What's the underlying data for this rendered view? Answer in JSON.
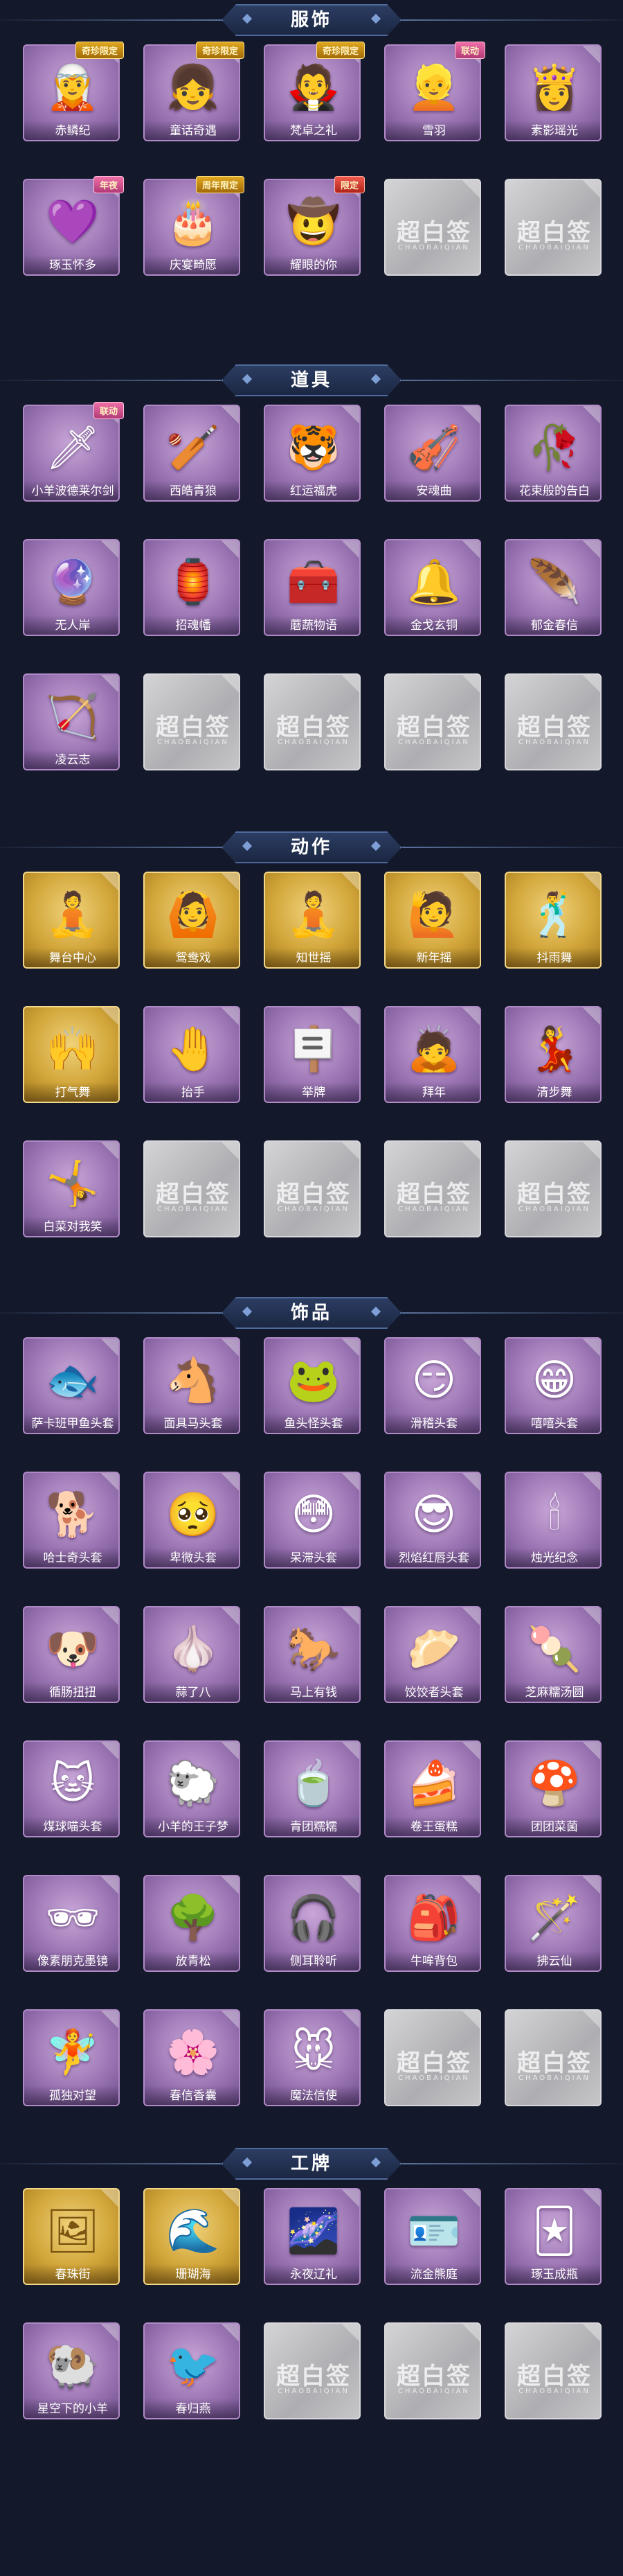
{
  "watermark": {
    "text": "超白签",
    "sub": "CHAOBAIQIAN"
  },
  "sections": [
    {
      "title": "服饰",
      "items": [
        {
          "label": "赤鳞纪",
          "style": "purple",
          "icon": "🧝",
          "badge": "奇珍限定"
        },
        {
          "label": "童话奇遇",
          "style": "purple",
          "icon": "👧",
          "badge": "奇珍限定"
        },
        {
          "label": "梵卓之礼",
          "style": "purple",
          "icon": "🧛",
          "badge": "奇珍限定"
        },
        {
          "label": "雪羽",
          "style": "purple",
          "icon": "👱",
          "badge": "联动"
        },
        {
          "label": "素影瑶光",
          "style": "purple",
          "icon": "👸"
        },
        {
          "label": "琢玉怀多",
          "style": "purple",
          "icon": "💜",
          "badge": "年夜"
        },
        {
          "label": "庆宴畸愿",
          "style": "purple",
          "icon": "🎂",
          "badge": "周年限定"
        },
        {
          "label": "耀眼的你",
          "style": "purple",
          "icon": "🤠",
          "badge": "限定"
        },
        {
          "style": "empty"
        },
        {
          "style": "empty"
        }
      ]
    },
    {
      "title": "道具",
      "items": [
        {
          "label": "小羊波德莱尔剑",
          "style": "purple",
          "icon": "🗡",
          "badge": "联动"
        },
        {
          "label": "西皓青狼",
          "style": "purple",
          "icon": "🏏"
        },
        {
          "label": "红运福虎",
          "style": "purple",
          "icon": "🐯"
        },
        {
          "label": "安魂曲",
          "style": "purple",
          "icon": "🎻"
        },
        {
          "label": "花束般的告白",
          "style": "purple",
          "icon": "🥀"
        },
        {
          "label": "无人岸",
          "style": "purple",
          "icon": "🔮"
        },
        {
          "label": "招魂幡",
          "style": "purple",
          "icon": "🏮"
        },
        {
          "label": "蘑蔬物语",
          "style": "purple",
          "icon": "🧰"
        },
        {
          "label": "金戈玄铜",
          "style": "purple",
          "icon": "🔔"
        },
        {
          "label": "郁金春信",
          "style": "purple",
          "icon": "🪶"
        },
        {
          "label": "凌云志",
          "style": "purple",
          "icon": "🏹"
        },
        {
          "style": "empty"
        },
        {
          "style": "empty"
        },
        {
          "style": "empty"
        },
        {
          "style": "empty"
        }
      ]
    },
    {
      "title": "动作",
      "items": [
        {
          "label": "舞台中心",
          "style": "gold",
          "icon": "🧘"
        },
        {
          "label": "鸳鸯戏",
          "style": "gold",
          "icon": "🙆"
        },
        {
          "label": "知世摇",
          "style": "gold",
          "icon": "🧘"
        },
        {
          "label": "新年摇",
          "style": "gold",
          "icon": "🙋"
        },
        {
          "label": "抖雨舞",
          "style": "gold",
          "icon": "🕺"
        },
        {
          "label": "打气舞",
          "style": "gold",
          "icon": "🙌"
        },
        {
          "label": "抬手",
          "style": "purple",
          "icon": "🤚"
        },
        {
          "label": "举牌",
          "style": "purple",
          "icon": "🪧"
        },
        {
          "label": "拜年",
          "style": "purple",
          "icon": "🙇"
        },
        {
          "label": "清步舞",
          "style": "purple",
          "icon": "💃"
        },
        {
          "label": "白菜对我笑",
          "style": "purple",
          "icon": "🤸"
        },
        {
          "style": "empty"
        },
        {
          "style": "empty"
        },
        {
          "style": "empty"
        },
        {
          "style": "empty"
        }
      ]
    },
    {
      "title": "饰品",
      "items": [
        {
          "label": "萨卡班甲鱼头套",
          "style": "purple",
          "icon": "🐟"
        },
        {
          "label": "面具马头套",
          "style": "purple",
          "icon": "🐴"
        },
        {
          "label": "鱼头怪头套",
          "style": "purple",
          "icon": "🐸"
        },
        {
          "label": "滑稽头套",
          "style": "purple",
          "icon": "😏"
        },
        {
          "label": "嘻嘻头套",
          "style": "purple",
          "icon": "😁"
        },
        {
          "label": "哈士奇头套",
          "style": "purple",
          "icon": "🐕"
        },
        {
          "label": "卑微头套",
          "style": "purple",
          "icon": "🥺"
        },
        {
          "label": "呆滞头套",
          "style": "purple",
          "icon": "😳"
        },
        {
          "label": "烈焰红唇头套",
          "style": "purple",
          "icon": "😎"
        },
        {
          "label": "烛光纪念",
          "style": "purple",
          "icon": "🕯"
        },
        {
          "label": "循肠扭扭",
          "style": "purple",
          "icon": "🐶"
        },
        {
          "label": "蒜了八",
          "style": "purple",
          "icon": "🧄"
        },
        {
          "label": "马上有钱",
          "style": "purple",
          "icon": "🐎"
        },
        {
          "label": "饺饺者头套",
          "style": "purple",
          "icon": "🥟"
        },
        {
          "label": "芝麻糯汤圆",
          "style": "purple",
          "icon": "🍡"
        },
        {
          "label": "煤球喵头套",
          "style": "purple",
          "icon": "🐱"
        },
        {
          "label": "小羊的王子梦",
          "style": "purple",
          "icon": "🐑"
        },
        {
          "label": "青团糯糯",
          "style": "purple",
          "icon": "🍵"
        },
        {
          "label": "卷王蛋糕",
          "style": "purple",
          "icon": "🍰"
        },
        {
          "label": "团团菜菌",
          "style": "purple",
          "icon": "🍄"
        },
        {
          "label": "像素朋克墨镜",
          "style": "purple",
          "icon": "🕶"
        },
        {
          "label": "放青松",
          "style": "purple",
          "icon": "🌳"
        },
        {
          "label": "侧耳聆听",
          "style": "purple",
          "icon": "🎧"
        },
        {
          "label": "牛哞背包",
          "style": "purple",
          "icon": "🎒"
        },
        {
          "label": "拂云仙",
          "style": "purple",
          "icon": "🪄"
        },
        {
          "label": "孤独对望",
          "style": "purple",
          "icon": "🧚"
        },
        {
          "label": "春信香囊",
          "style": "purple",
          "icon": "🌸"
        },
        {
          "label": "魔法信使",
          "style": "purple",
          "icon": "🐭"
        },
        {
          "style": "empty"
        },
        {
          "style": "empty"
        }
      ]
    },
    {
      "title": "工牌",
      "items": [
        {
          "label": "春珠街",
          "style": "gold",
          "icon": "🖼"
        },
        {
          "label": "珊瑚海",
          "style": "gold",
          "icon": "🌊"
        },
        {
          "label": "永夜辽礼",
          "style": "purple",
          "icon": "🌌"
        },
        {
          "label": "流金熊庭",
          "style": "purple",
          "icon": "🪪"
        },
        {
          "label": "琢玉成瓶",
          "style": "purple",
          "icon": "🃏"
        },
        {
          "label": "星空下的小羊",
          "style": "purple",
          "icon": "🐏"
        },
        {
          "label": "春归燕",
          "style": "purple",
          "icon": "🐦"
        },
        {
          "style": "empty"
        },
        {
          "style": "empty"
        },
        {
          "style": "empty"
        }
      ]
    }
  ]
}
